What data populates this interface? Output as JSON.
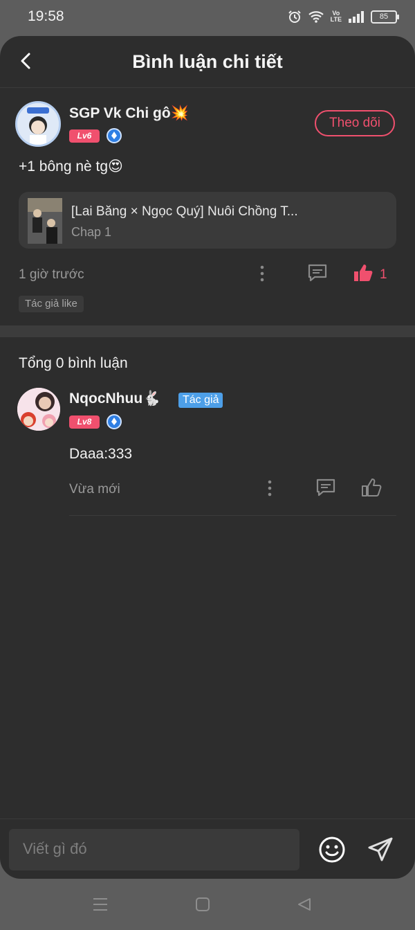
{
  "status_bar": {
    "time": "19:58",
    "battery": "85",
    "network": "Vo LTE"
  },
  "header": {
    "title": "Bình luận chi tiết"
  },
  "post": {
    "user": {
      "name": "SGP Vk Chi gô💥",
      "level": "Lv6",
      "avatar_badge": "WRITER"
    },
    "follow_label": "Theo dõi",
    "content": "+1 bông nè tg😍",
    "reference": {
      "title": "[Lai Băng × Ngọc Quý] Nuôi Chồng T...",
      "subtitle": "Chap 1"
    },
    "time": "1 giờ trước",
    "like_count": "1",
    "tag": "Tác giả like"
  },
  "comments_section": {
    "total_label": "Tổng 0 bình luận",
    "items": [
      {
        "name": "NqocNhuu🐇",
        "role_tag": "Tác giả",
        "level": "Lv8",
        "content": "Daaa:333",
        "time": "Vừa mới"
      }
    ]
  },
  "composer": {
    "placeholder": "Viết gì đó"
  },
  "colors": {
    "accent": "#f0506e",
    "author_tag": "#4d9fe8",
    "sheet_bg": "#2d2d2d"
  }
}
